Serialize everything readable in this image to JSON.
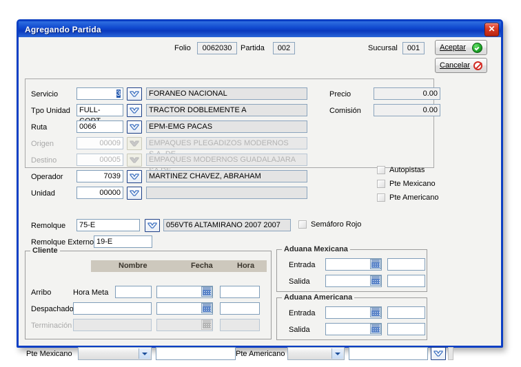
{
  "window": {
    "title": "Agregando Partida",
    "close_label": "✕"
  },
  "header": {
    "folio_label": "Folio",
    "folio_value": "0062030",
    "partida_label": "Partida",
    "partida_value": "002",
    "sucursal_label": "Sucursal",
    "sucursal_value": "001",
    "accept_label": "Aceptar",
    "cancel_label": "Cancelar"
  },
  "fields": [
    {
      "label": "Servicio",
      "code": "",
      "code_selected": "3",
      "desc": "FORANEO NACIONAL",
      "disabled": false,
      "code_align": "right"
    },
    {
      "label": "Tpo Unidad",
      "code": "FULL-CORT",
      "desc": "TRACTOR DOBLEMENTE A",
      "disabled": false,
      "code_align": "left"
    },
    {
      "label": "Ruta",
      "code": "0066",
      "desc": "EPM-EMG PACAS",
      "disabled": false,
      "code_align": "left"
    },
    {
      "label": "Origen",
      "code": "00009",
      "desc": "EMPAQUES PLEGADIZOS MODERNOS S.A. DE",
      "disabled": true,
      "code_align": "right"
    },
    {
      "label": "Destino",
      "code": "00005",
      "desc": "EMPAQUES MODERNOS GUADALAJARA SA DE",
      "disabled": true,
      "code_align": "right"
    },
    {
      "label": "Operador",
      "code": "7039",
      "desc": "MARTINEZ CHAVEZ, ABRAHAM",
      "disabled": false,
      "code_align": "right"
    },
    {
      "label": "Unidad",
      "code": "00000",
      "desc": "",
      "disabled": false,
      "code_align": "right"
    }
  ],
  "money": {
    "precio_label": "Precio",
    "precio_value": "0.00",
    "comision_label": "Comisión",
    "comision_value": "0.00"
  },
  "checkboxes": [
    {
      "label": "Autopistas",
      "checked": false
    },
    {
      "label": "Pte Mexicano",
      "checked": false
    },
    {
      "label": "Pte Americano",
      "checked": false
    }
  ],
  "remolque": {
    "label": "Remolque",
    "value": "75-E",
    "desc": "056VT6 ALTAMIRANO 2007 2007",
    "externo_label": "Remolque Externo",
    "externo_value": "19-E",
    "semaforo_label": "Semáforo Rojo",
    "semaforo_checked": false
  },
  "cliente": {
    "title": "Cliente",
    "columns": [
      "Nombre",
      "Fecha",
      "Hora"
    ],
    "rows": [
      {
        "label": "Arribo",
        "sublabel": "Hora Meta",
        "nombre": "",
        "fecha": "",
        "hora": "",
        "disabled": false
      },
      {
        "label": "Despachado",
        "sublabel": "",
        "nombre": "",
        "fecha": "",
        "hora": "",
        "disabled": false
      },
      {
        "label": "Terminación",
        "sublabel": "",
        "nombre": "",
        "fecha": "",
        "hora": "",
        "disabled": true
      }
    ]
  },
  "aduana_mexicana": {
    "title": "Aduana Mexicana",
    "rows": [
      {
        "label": "Entrada",
        "fecha": "",
        "hora": ""
      },
      {
        "label": "Salida",
        "fecha": "",
        "hora": ""
      }
    ]
  },
  "aduana_americana": {
    "title": "Aduana Americana",
    "rows": [
      {
        "label": "Entrada",
        "fecha": "",
        "hora": ""
      },
      {
        "label": "Salida",
        "fecha": "",
        "hora": ""
      }
    ]
  },
  "bottom": {
    "pte_mexicano_label": "Pte Mexicano",
    "pte_mexicano_select": "",
    "pte_mexicano_value": "",
    "pte_americano_label": "Pte Americano",
    "pte_americano_select": "",
    "pte_americano_value": ""
  },
  "colors": {
    "title_blue": "#0b3fc4",
    "field_border": "#7f9db9",
    "readonly_bg": "#e4e4e4",
    "close_red": "#d83a22",
    "header_strip": "#cdc8bd"
  }
}
